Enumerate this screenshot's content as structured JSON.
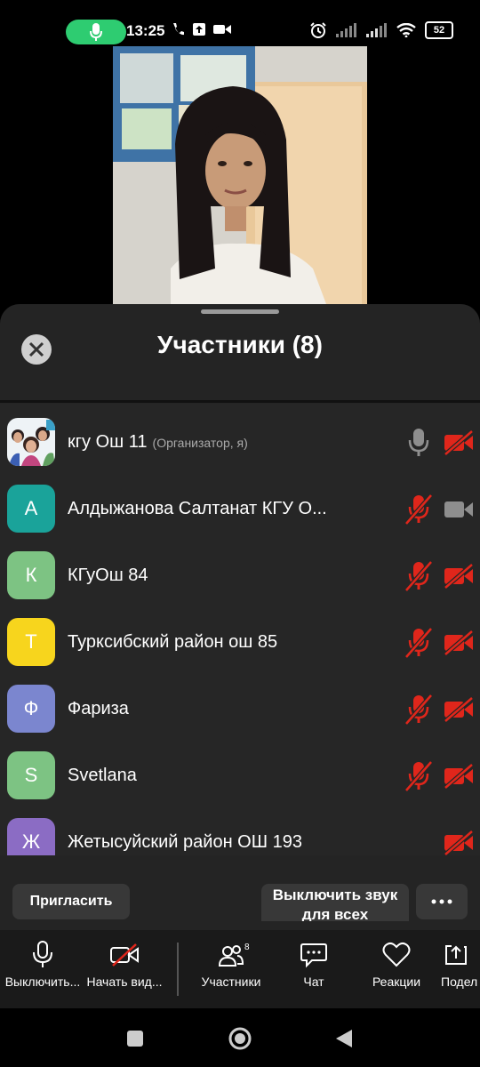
{
  "status_bar": {
    "time": "13:25",
    "battery": "52"
  },
  "sheet": {
    "title": "Участники (8)"
  },
  "participants": [
    {
      "name": "кгу Ош 11",
      "role": "(Организатор, я)",
      "avatar_letter": "",
      "avatar_color": "#7a6a8a",
      "mic": "on",
      "video": "off"
    },
    {
      "name": "Алдыжанова Салтанат КГУ О...",
      "role": "",
      "avatar_letter": "А",
      "avatar_color": "#1aa39a",
      "mic": "muted",
      "video": "on"
    },
    {
      "name": "КГуОш 84",
      "role": "",
      "avatar_letter": "К",
      "avatar_color": "#7dc383",
      "mic": "muted",
      "video": "off"
    },
    {
      "name": "Турксибский район ош 85",
      "role": "",
      "avatar_letter": "Т",
      "avatar_color": "#f7d51d",
      "mic": "muted",
      "video": "off"
    },
    {
      "name": "Фариза",
      "role": "",
      "avatar_letter": "Ф",
      "avatar_color": "#7b86cf",
      "mic": "muted",
      "video": "off"
    },
    {
      "name": "Svetlana",
      "role": "",
      "avatar_letter": "S",
      "avatar_color": "#7dc383",
      "mic": "muted",
      "video": "off"
    },
    {
      "name": "Жетысуйский район ОШ 193",
      "role": "",
      "avatar_letter": "Ж",
      "avatar_color": "#8b6cc4",
      "mic": "none",
      "video": "off"
    }
  ],
  "actions": {
    "invite_label": "Пригласить",
    "mute_all_label": "Выключить звук для всех"
  },
  "toolbar": {
    "mute_label": "Выключить...",
    "video_label": "Начать вид...",
    "participants_label": "Участники",
    "participants_count": "8",
    "chat_label": "Чат",
    "reactions_label": "Реакции",
    "share_label": "Подел"
  },
  "colors": {
    "muted_red": "#e0261b",
    "icon_gray": "#8e8e8e",
    "mic_pill_green": "#2ecc71"
  }
}
